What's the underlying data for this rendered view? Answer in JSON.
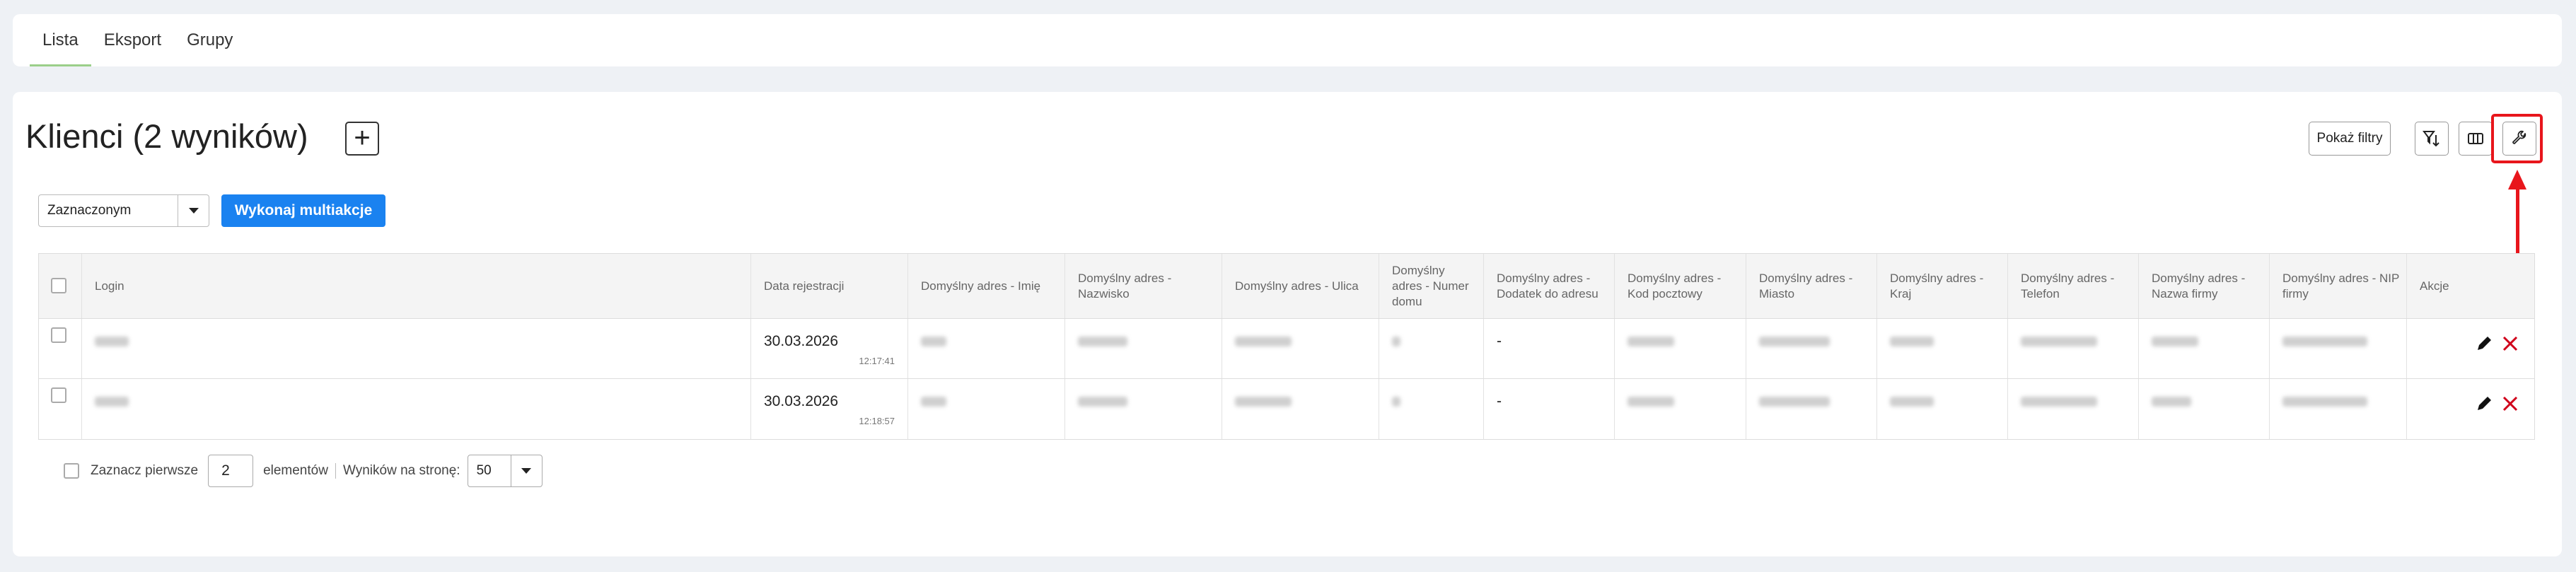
{
  "tabs": [
    {
      "label": "Lista",
      "active": true
    },
    {
      "label": "Eksport",
      "active": false
    },
    {
      "label": "Grupy",
      "active": false
    }
  ],
  "header": {
    "title": "Klienci (2 wyników)",
    "add_label": "+",
    "show_filters_label": "Pokaż filtry"
  },
  "multiaction": {
    "select_value": "Zaznaczonym",
    "execute_label": "Wykonaj multiakcje"
  },
  "table": {
    "columns": [
      "Login",
      "Data rejestracji",
      "Domyślny adres - Imię",
      "Domyślny adres - Nazwisko",
      "Domyślny adres - Ulica",
      "Domyślny adres - Numer domu",
      "Domyślny adres - Dodatek do adresu",
      "Domyślny adres - Kod pocztowy",
      "Domyślny adres - Miasto",
      "Domyślny adres - Kraj",
      "Domyślny adres - Telefon",
      "Domyślny adres - Nazwa firmy",
      "Domyślny adres - NIP firmy",
      "Akcje"
    ],
    "rows": [
      {
        "date": "30.03.2026",
        "time": "12:17:41",
        "address_extra": "-"
      },
      {
        "date": "30.03.2026",
        "time": "12:18:57",
        "address_extra": "-"
      }
    ]
  },
  "footer": {
    "select_first_label": "Zaznacz pierwsze",
    "select_first_value": "2",
    "elements_label": "elementów",
    "per_page_label": "Wyników na stronę:",
    "per_page_value": "50"
  },
  "colors": {
    "primary": "#1a82f0",
    "highlight": "#e8161c",
    "active_tab_underline": "#9bcf8a",
    "delete_icon": "#d0021b"
  },
  "icons": [
    "plus-icon",
    "filter-sort-icon",
    "columns-icon",
    "wrench-icon",
    "chevron-down-icon",
    "pencil-icon",
    "close-icon",
    "arrow-up-icon"
  ]
}
